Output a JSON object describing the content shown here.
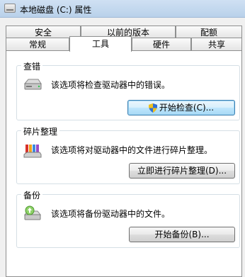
{
  "window": {
    "title": "本地磁盘 (C:) 属性"
  },
  "tabs": {
    "row_back": [
      "安全",
      "以前的版本",
      "配额"
    ],
    "row_front": [
      "常规",
      "工具",
      "硬件",
      "共享"
    ],
    "active": "工具"
  },
  "sections": {
    "error_check": {
      "label": "查错",
      "description": "该选项将检查驱动器中的错误。",
      "button": "开始检查(C)...",
      "icon": "disk-drive-icon"
    },
    "defrag": {
      "label": "碎片整理",
      "description": "该选项将对驱动器中的文件进行碎片整理。",
      "button": "立即进行碎片整理(D)...",
      "icon": "defrag-icon"
    },
    "backup": {
      "label": "备份",
      "description": "该选项将备份驱动器中的文件。",
      "button": "开始备份(B)...",
      "icon": "backup-icon"
    }
  },
  "colors": {
    "tab_border": "#8e8f8f",
    "focused_button_border": "#3c7fb1",
    "titlebar": "#c4d9ef"
  }
}
